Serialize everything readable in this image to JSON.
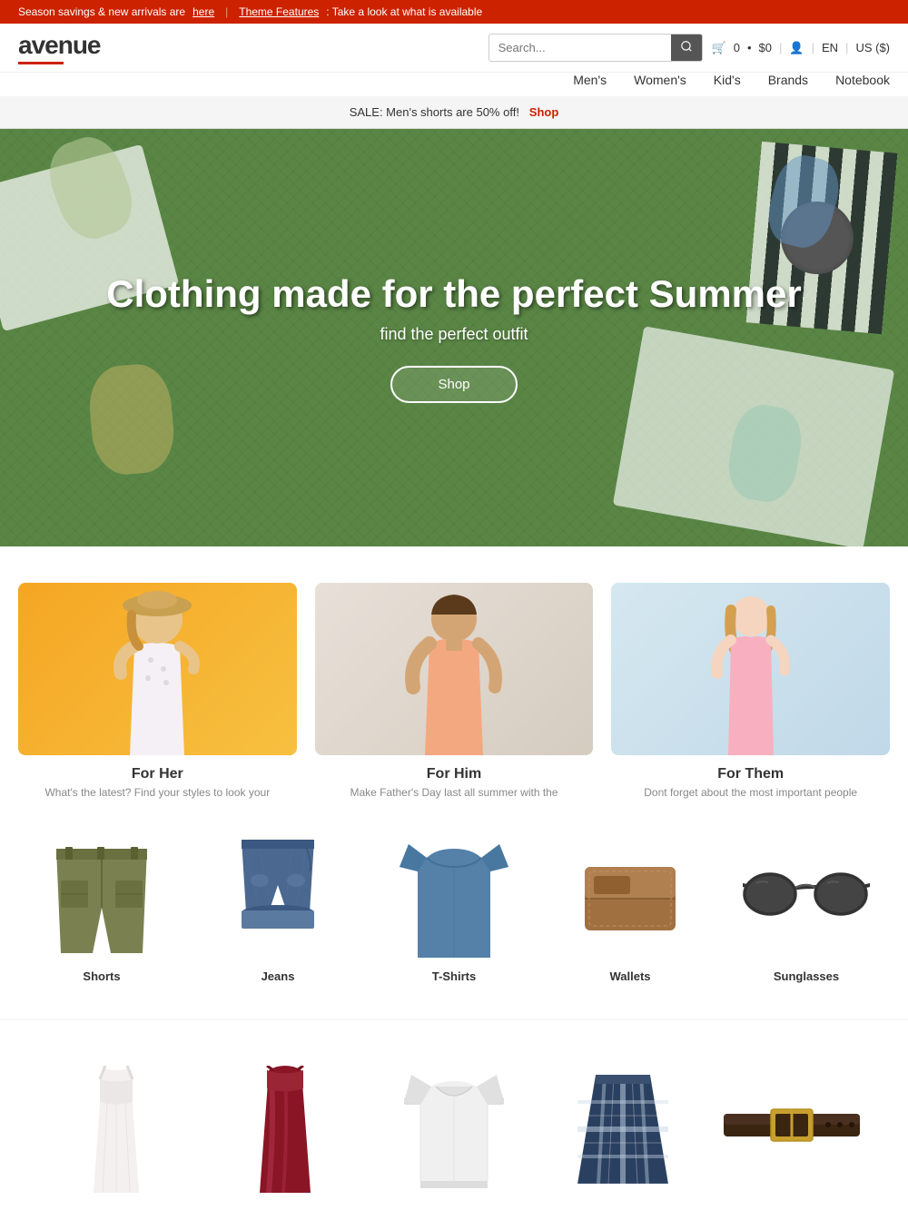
{
  "announcement": {
    "text1": "Season savings & new arrivals are ",
    "link1": "here",
    "separator": "|",
    "text2": "Theme Features",
    "text3": ": Take a look at what is available"
  },
  "header": {
    "logo": "avenue",
    "search_placeholder": "Search...",
    "cart_count": "0",
    "cart_price": "$0",
    "lang": "EN",
    "currency": "US ($)"
  },
  "nav": {
    "items": [
      {
        "label": "Men's",
        "id": "mens"
      },
      {
        "label": "Women's",
        "id": "womens"
      },
      {
        "label": "Kid's",
        "id": "kids"
      },
      {
        "label": "Brands",
        "id": "brands"
      },
      {
        "label": "Notebook",
        "id": "notebook"
      }
    ]
  },
  "sale_bar": {
    "text": "SALE: Men's shorts are 50% off!",
    "link": "Shop"
  },
  "hero": {
    "title": "Clothing made for the perfect Summer",
    "subtitle": "find the perfect outfit",
    "cta": "Shop"
  },
  "categories": [
    {
      "id": "for-her",
      "title": "For Her",
      "description": "What's the latest? Find your styles to look your"
    },
    {
      "id": "for-him",
      "title": "For Him",
      "description": "Make Father's Day last all summer with the"
    },
    {
      "id": "for-them",
      "title": "For Them",
      "description": "Dont forget about the most important people"
    }
  ],
  "products_row1": [
    {
      "id": "shorts",
      "label": "Shorts"
    },
    {
      "id": "jeans",
      "label": "Jeans"
    },
    {
      "id": "tshirts",
      "label": "T-Shirts"
    },
    {
      "id": "wallets",
      "label": "Wallets"
    },
    {
      "id": "sunglasses",
      "label": "Sunglasses"
    }
  ],
  "products_row2": [
    {
      "id": "dress",
      "label": ""
    },
    {
      "id": "red-dress",
      "label": ""
    },
    {
      "id": "sweater",
      "label": ""
    },
    {
      "id": "skirt",
      "label": ""
    },
    {
      "id": "belt",
      "label": ""
    }
  ]
}
